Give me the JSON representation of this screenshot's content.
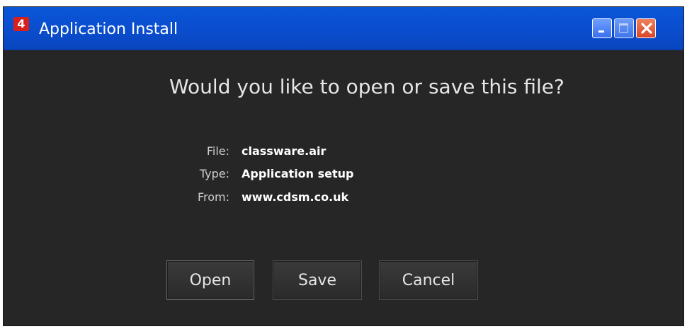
{
  "window": {
    "title": "Application Install",
    "logo_icon": "adobe-air-icon",
    "logo_glyph": "4"
  },
  "dialog": {
    "heading": "Would you like to open or save this file?",
    "fields": [
      {
        "label": "File:",
        "value": "classware.air"
      },
      {
        "label": "Type:",
        "value": "Application setup"
      },
      {
        "label": "From:",
        "value": "www.cdsm.co.uk"
      }
    ]
  },
  "buttons": {
    "open": "Open",
    "save": "Save",
    "cancel": "Cancel"
  },
  "colors": {
    "titlebar": "#0a4fd0",
    "window_bg": "#262626",
    "close_button": "#d8452a",
    "logo": "#d6201b"
  }
}
